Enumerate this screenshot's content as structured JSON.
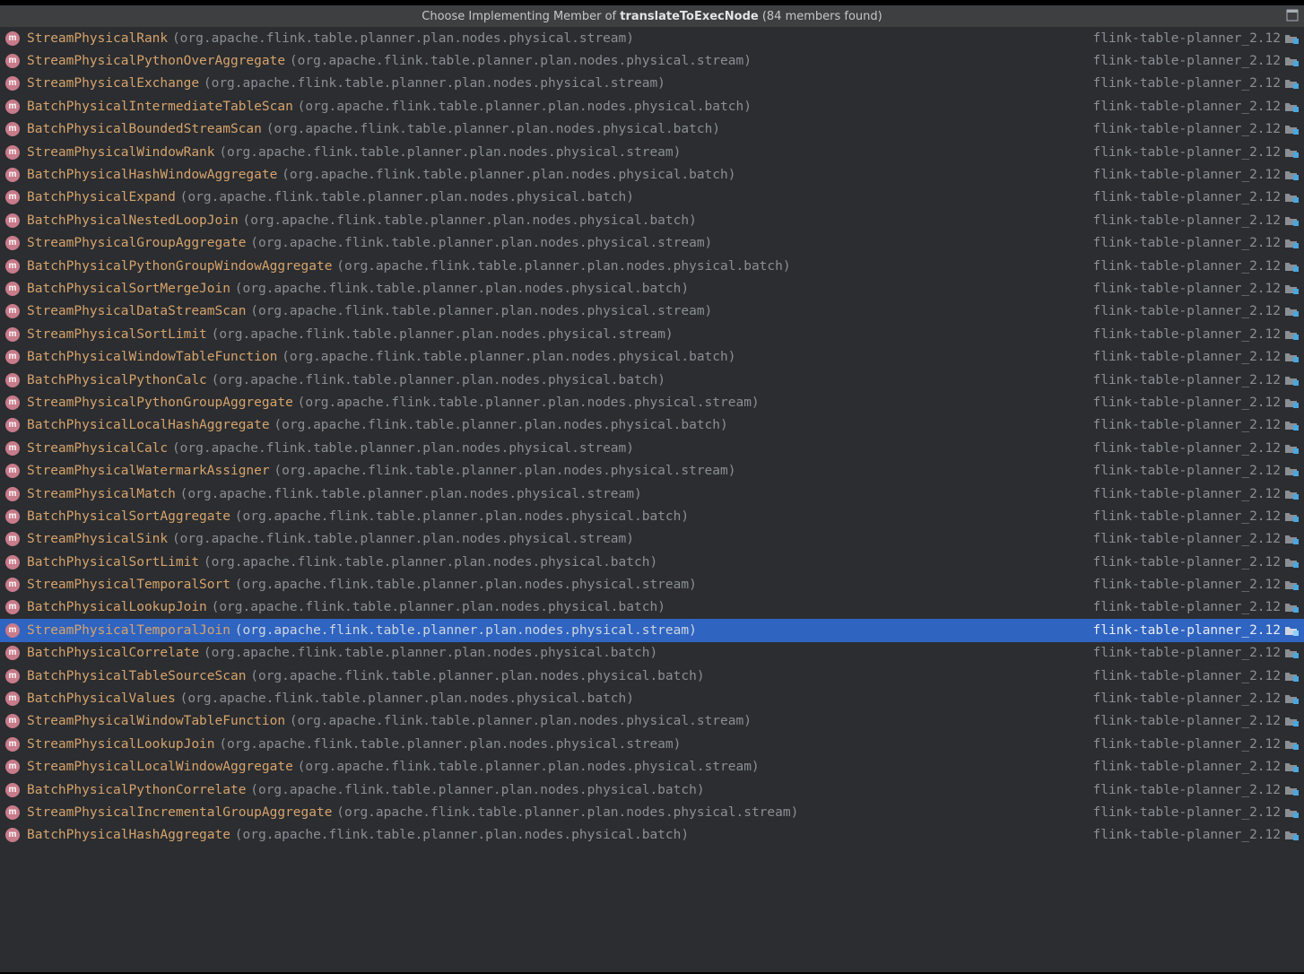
{
  "title": {
    "prefix": "Choose Implementing Member of ",
    "member": "translateToExecNode",
    "suffix": " (84 members found)"
  },
  "module": "flink-table-planner_2.12",
  "pkg_stream": "(org.apache.flink.table.planner.plan.nodes.physical.stream)",
  "pkg_batch": "(org.apache.flink.table.planner.plan.nodes.physical.batch)",
  "selected_index": 26,
  "rows": [
    {
      "name": "StreamPhysicalRank",
      "pkg": "stream"
    },
    {
      "name": "StreamPhysicalPythonOverAggregate",
      "pkg": "stream"
    },
    {
      "name": "StreamPhysicalExchange",
      "pkg": "stream"
    },
    {
      "name": "BatchPhysicalIntermediateTableScan",
      "pkg": "batch"
    },
    {
      "name": "BatchPhysicalBoundedStreamScan",
      "pkg": "batch"
    },
    {
      "name": "StreamPhysicalWindowRank",
      "pkg": "stream"
    },
    {
      "name": "BatchPhysicalHashWindowAggregate",
      "pkg": "batch"
    },
    {
      "name": "BatchPhysicalExpand",
      "pkg": "batch"
    },
    {
      "name": "BatchPhysicalNestedLoopJoin",
      "pkg": "batch"
    },
    {
      "name": "StreamPhysicalGroupAggregate",
      "pkg": "stream"
    },
    {
      "name": "BatchPhysicalPythonGroupWindowAggregate",
      "pkg": "batch"
    },
    {
      "name": "BatchPhysicalSortMergeJoin",
      "pkg": "batch"
    },
    {
      "name": "StreamPhysicalDataStreamScan",
      "pkg": "stream"
    },
    {
      "name": "StreamPhysicalSortLimit",
      "pkg": "stream"
    },
    {
      "name": "BatchPhysicalWindowTableFunction",
      "pkg": "batch"
    },
    {
      "name": "BatchPhysicalPythonCalc",
      "pkg": "batch"
    },
    {
      "name": "StreamPhysicalPythonGroupAggregate",
      "pkg": "stream"
    },
    {
      "name": "BatchPhysicalLocalHashAggregate",
      "pkg": "batch"
    },
    {
      "name": "StreamPhysicalCalc",
      "pkg": "stream"
    },
    {
      "name": "StreamPhysicalWatermarkAssigner",
      "pkg": "stream"
    },
    {
      "name": "StreamPhysicalMatch",
      "pkg": "stream"
    },
    {
      "name": "BatchPhysicalSortAggregate",
      "pkg": "batch"
    },
    {
      "name": "StreamPhysicalSink",
      "pkg": "stream"
    },
    {
      "name": "BatchPhysicalSortLimit",
      "pkg": "batch"
    },
    {
      "name": "StreamPhysicalTemporalSort",
      "pkg": "stream"
    },
    {
      "name": "BatchPhysicalLookupJoin",
      "pkg": "batch"
    },
    {
      "name": "StreamPhysicalTemporalJoin",
      "pkg": "stream"
    },
    {
      "name": "BatchPhysicalCorrelate",
      "pkg": "batch"
    },
    {
      "name": "BatchPhysicalTableSourceScan",
      "pkg": "batch"
    },
    {
      "name": "BatchPhysicalValues",
      "pkg": "batch"
    },
    {
      "name": "StreamPhysicalWindowTableFunction",
      "pkg": "stream"
    },
    {
      "name": "StreamPhysicalLookupJoin",
      "pkg": "stream"
    },
    {
      "name": "StreamPhysicalLocalWindowAggregate",
      "pkg": "stream"
    },
    {
      "name": "BatchPhysicalPythonCorrelate",
      "pkg": "batch"
    },
    {
      "name": "StreamPhysicalIncrementalGroupAggregate",
      "pkg": "stream"
    },
    {
      "name": "BatchPhysicalHashAggregate",
      "pkg": "batch"
    }
  ]
}
